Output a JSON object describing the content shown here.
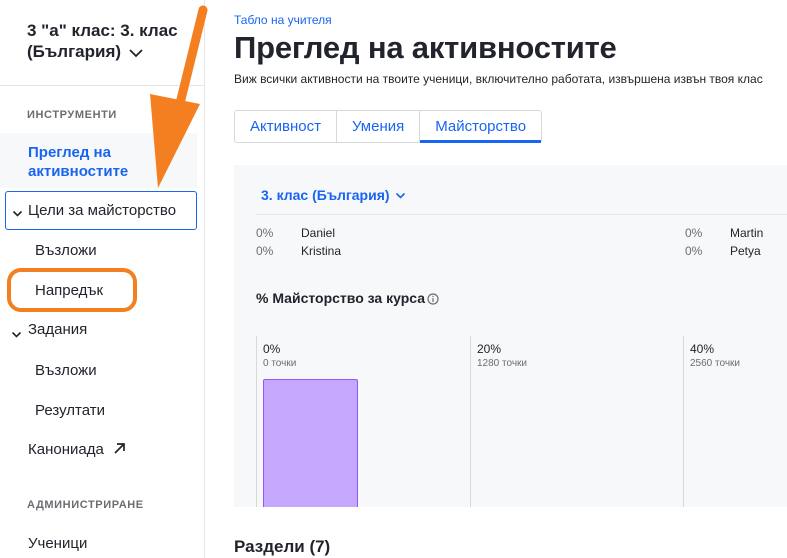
{
  "sidebar": {
    "class_title": "3 \"а\" клас: 3. клас (България)",
    "tools_section": "ИНСТРУМЕНТИ",
    "activity_overview": "Преглед на активностите",
    "mastery_goals": "Цели за майсторство",
    "mastery_assign": "Възложи",
    "mastery_progress": "Напредък",
    "assignments": "Задания",
    "assignments_assign": "Възложи",
    "assignments_results": "Резултати",
    "kanoniada": "Канониада",
    "admin_section": "АДМИНИСТРИРАНЕ",
    "students": "Ученици"
  },
  "header": {
    "breadcrumb": "Табло на учителя",
    "title": "Преглед на активностите",
    "subtitle": "Виж всички активности на твоите ученици, включително работата, извършена извън твоя клас"
  },
  "tabs": [
    {
      "label": "Активност",
      "active": false
    },
    {
      "label": "Умения",
      "active": false
    },
    {
      "label": "Майсторство",
      "active": true
    }
  ],
  "panel": {
    "class_selector": "3. клас (България)",
    "students": [
      {
        "pct": "0%",
        "name": "Daniel"
      },
      {
        "pct": "0%",
        "name": "Kristina"
      },
      {
        "pct": "0%",
        "name": "Martin"
      },
      {
        "pct": "0%",
        "name": "Petya"
      }
    ],
    "mastery_title": "% Майсторство за курса",
    "columns": [
      {
        "pct": "0%",
        "points": "0 точки"
      },
      {
        "pct": "20%",
        "points": "1280 точки"
      },
      {
        "pct": "40%",
        "points": "2560 точки"
      }
    ]
  },
  "sections_title": "Раздели (7)",
  "colors": {
    "accent": "#1865f2",
    "highlight": "#f47f20",
    "bar_fill": "#c5a8fd",
    "bar_border": "#9059ff"
  },
  "icons": [
    "chevron-down-icon",
    "external-link-icon",
    "info-icon",
    "arrow-annotation"
  ]
}
